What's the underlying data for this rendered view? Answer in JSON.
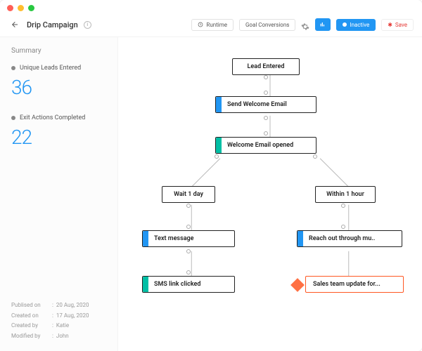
{
  "header": {
    "title": "Drip Campaign",
    "runtime_label": "Runtime",
    "goal_label": "Goal Conversions",
    "inactive_label": "Inactive",
    "save_label": "Save"
  },
  "sidebar": {
    "summary_title": "Summary",
    "stat1_label": "Unique Leads Entered",
    "stat1_value": "36",
    "stat2_label": "Exit Actions Completed",
    "stat2_value": "22",
    "meta": {
      "published_k": "Publised on",
      "published_v": "20 Aug, 2020",
      "created_k": "Created on",
      "created_v": "17 Aug, 2020",
      "createdby_k": "Created by",
      "createdby_v": "Katie",
      "modified_k": "Modified by",
      "modified_v": "John"
    }
  },
  "nodes": {
    "lead": "Lead Entered",
    "welcome": "Send Welcome Email",
    "opened": "Welcome Email opened",
    "wait": "Wait 1 day",
    "within": "Within 1 hour",
    "text": "Text message",
    "reach": "Reach out through mu..",
    "sms": "SMS link clicked",
    "sales": "Sales team update for..."
  }
}
